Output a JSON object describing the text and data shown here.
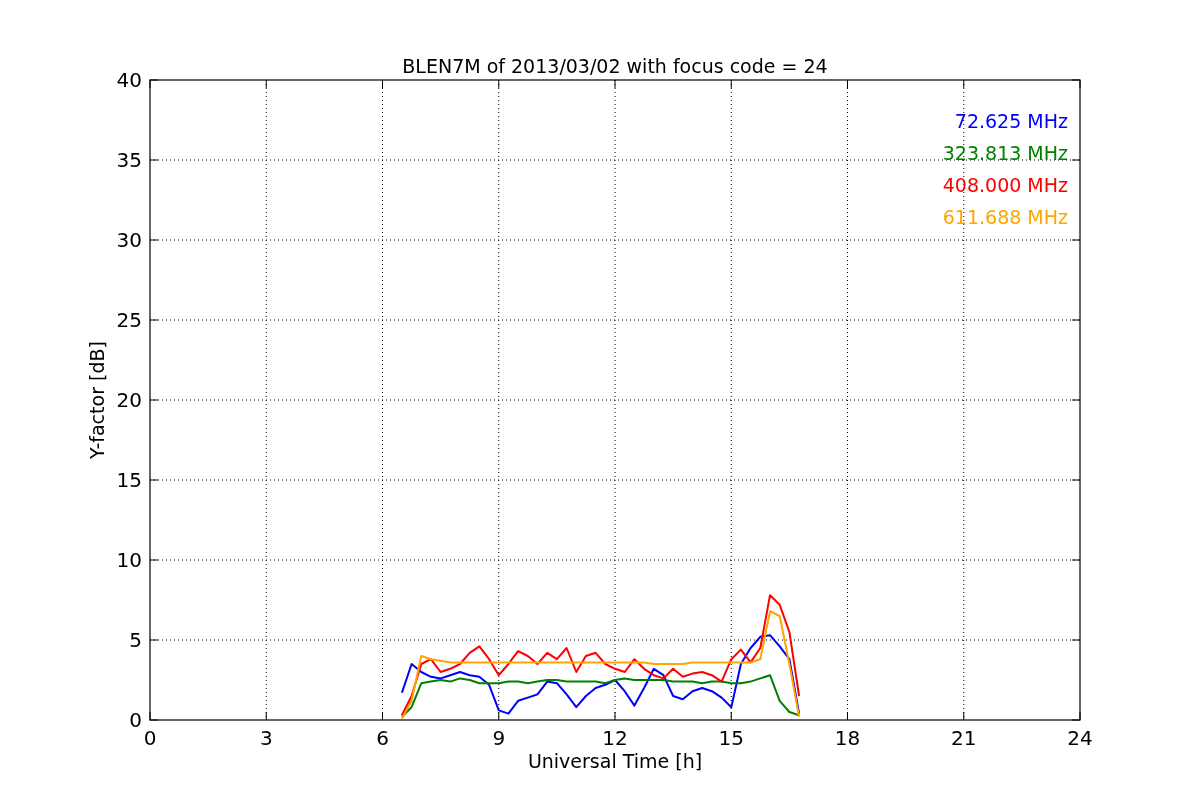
{
  "figure": {
    "chart_data": {
      "type": "line",
      "title": "BLEN7M of 2013/03/02 with focus code = 24",
      "xlabel": "Universal Time [h]",
      "ylabel": "Y-factor [dB]",
      "xlim": [
        0,
        24
      ],
      "ylim": [
        0,
        40
      ],
      "xticks": [
        0,
        3,
        6,
        9,
        12,
        15,
        18,
        21,
        24
      ],
      "yticks": [
        0,
        5,
        10,
        15,
        20,
        25,
        30,
        35,
        40
      ],
      "grid": true,
      "x": [
        6.5,
        6.75,
        7,
        7.25,
        7.5,
        7.75,
        8,
        8.25,
        8.5,
        8.75,
        9,
        9.25,
        9.5,
        9.75,
        10,
        10.25,
        10.5,
        10.75,
        11,
        11.25,
        11.5,
        11.75,
        12,
        12.25,
        12.5,
        12.75,
        13,
        13.25,
        13.5,
        13.75,
        14,
        14.25,
        14.5,
        14.75,
        15,
        15.25,
        15.5,
        15.75,
        16,
        16.25,
        16.5,
        16.75
      ],
      "series": [
        {
          "name": "72.625 MHz",
          "color": "#0000ff",
          "values": [
            1.7,
            3.5,
            3.0,
            2.7,
            2.6,
            2.8,
            3.0,
            2.8,
            2.7,
            2.2,
            0.6,
            0.4,
            1.2,
            1.4,
            1.6,
            2.4,
            2.3,
            1.6,
            0.8,
            1.5,
            2.0,
            2.2,
            2.5,
            1.8,
            0.9,
            2.0,
            3.2,
            2.8,
            1.5,
            1.3,
            1.8,
            2.0,
            1.8,
            1.4,
            0.8,
            3.5,
            4.5,
            5.2,
            5.3,
            4.6,
            3.8,
            0.4
          ]
        },
        {
          "name": "323.813 MHz",
          "color": "#008000",
          "values": [
            0.2,
            0.8,
            2.3,
            2.4,
            2.5,
            2.4,
            2.6,
            2.5,
            2.3,
            2.3,
            2.3,
            2.4,
            2.4,
            2.3,
            2.4,
            2.5,
            2.5,
            2.4,
            2.4,
            2.4,
            2.4,
            2.3,
            2.5,
            2.6,
            2.5,
            2.5,
            2.5,
            2.5,
            2.4,
            2.4,
            2.4,
            2.3,
            2.4,
            2.4,
            2.3,
            2.3,
            2.4,
            2.6,
            2.8,
            1.2,
            0.5,
            0.3
          ]
        },
        {
          "name": "408.000 MHz",
          "color": "#ff0000",
          "values": [
            0.3,
            1.5,
            3.5,
            3.8,
            3.0,
            3.2,
            3.5,
            4.2,
            4.6,
            3.8,
            2.8,
            3.5,
            4.3,
            4.0,
            3.5,
            4.2,
            3.8,
            4.5,
            3.0,
            4.0,
            4.2,
            3.5,
            3.2,
            3.0,
            3.8,
            3.2,
            2.8,
            2.6,
            3.2,
            2.7,
            2.9,
            3.0,
            2.8,
            2.4,
            3.8,
            4.4,
            3.6,
            4.5,
            7.8,
            7.2,
            5.5,
            1.5
          ]
        },
        {
          "name": "611.688 MHz",
          "color": "#ffa500",
          "values": [
            0.1,
            1.2,
            4.0,
            3.8,
            3.7,
            3.6,
            3.6,
            3.6,
            3.6,
            3.6,
            3.6,
            3.6,
            3.6,
            3.6,
            3.6,
            3.6,
            3.6,
            3.6,
            3.6,
            3.6,
            3.6,
            3.6,
            3.6,
            3.6,
            3.6,
            3.6,
            3.5,
            3.5,
            3.5,
            3.5,
            3.6,
            3.6,
            3.6,
            3.6,
            3.6,
            3.6,
            3.6,
            3.8,
            6.8,
            6.5,
            3.5,
            0.2
          ]
        }
      ]
    }
  }
}
